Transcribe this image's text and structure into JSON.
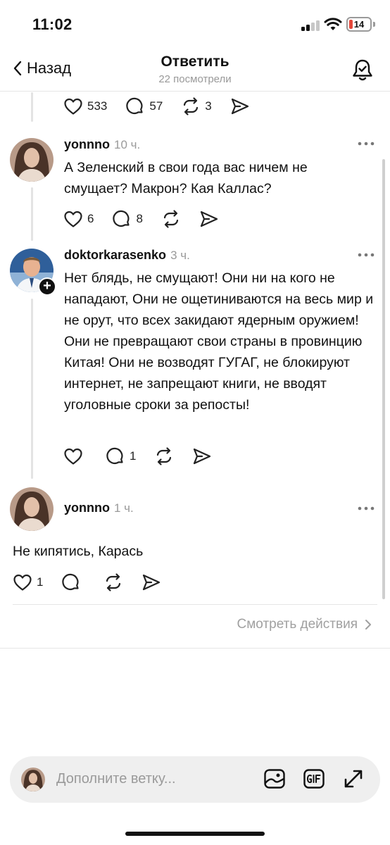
{
  "status_bar": {
    "time": "11:02",
    "battery": "14"
  },
  "header": {
    "back_label": "Назад",
    "title": "Ответить",
    "subtitle": "22 посмотрели"
  },
  "top_post_actions": {
    "likes": "533",
    "comments": "57",
    "reposts": "3"
  },
  "replies": [
    {
      "username": "yonnno",
      "time": "10 ч.",
      "text": "А Зеленский в свои года вас ничем не смущает? Макрон? Кая Каллас?",
      "likes": "6",
      "comments": "8"
    },
    {
      "username": "doktorkarasenko",
      "time": "3 ч.",
      "text": "Нет блядь, не смущают! Они ни на кого не нападают, Они не ощетиниваются на весь мир и не орут, что всех закидают ядерным оружием! Они не превращают свои страны в провинцию Китая! Они не возводят ГУГАГ, не блокируют интернет, не запрещают книги, не вводят уголовные сроки за репосты!",
      "likes": "",
      "comments": "1"
    },
    {
      "username": "yonnno",
      "time": "1 ч.",
      "text": "Не кипятись, Карась",
      "likes": "1",
      "comments": ""
    }
  ],
  "see_actions_label": "Смотреть действия",
  "composer": {
    "placeholder": "Дополните ветку..."
  },
  "colors": {
    "accent_red": "#e5483b",
    "muted": "#9a9a9a",
    "line": "#e3e3e3"
  }
}
